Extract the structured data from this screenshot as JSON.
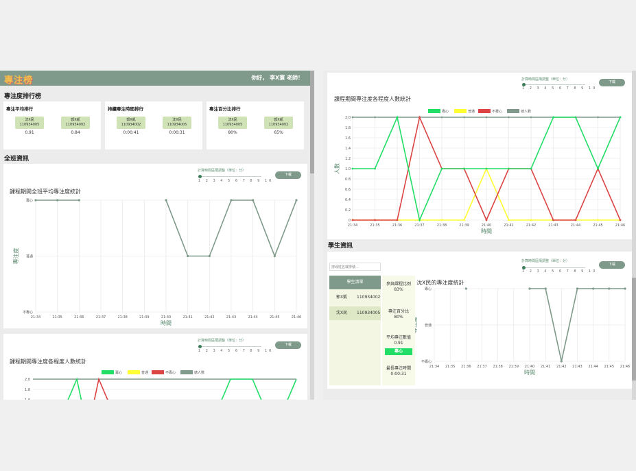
{
  "header": {
    "logo": "專注榜",
    "greeting": "你好， 李X寰 老師！"
  },
  "ranking": {
    "title": "專注度排行榜",
    "cards": [
      {
        "title": "專注平均排行",
        "entries": [
          {
            "name": "沈X民",
            "id": "110934005",
            "value": "0.91"
          },
          {
            "name": "郭X凱",
            "id": "110934002",
            "value": "0.84"
          }
        ]
      },
      {
        "title": "持續專注時間排行",
        "entries": [
          {
            "name": "郭X凱",
            "id": "110934002",
            "value": "0:00:41"
          },
          {
            "name": "沈X民",
            "id": "110934005",
            "value": "0:00:31"
          }
        ]
      },
      {
        "title": "專注百分比排行",
        "entries": [
          {
            "name": "沈X民",
            "id": "110934005",
            "value": "80%"
          },
          {
            "name": "郭X凱",
            "id": "110934002",
            "value": "65%"
          }
        ]
      }
    ]
  },
  "class_info": {
    "title": "全班資訊"
  },
  "controls": {
    "slider_label": "計算時間區隔調整（單位：分）",
    "slider_ticks": [
      "1",
      "2",
      "3",
      "4",
      "5",
      "6",
      "7",
      "8",
      "9",
      "10"
    ],
    "download_label": "下載"
  },
  "student_info": {
    "title": "學生資訊",
    "search_placeholder": "搜尋姓名或學號...",
    "list_header": "學生清單",
    "students": [
      {
        "name": "郭X凱",
        "id": "110934002"
      },
      {
        "name": "沈X民",
        "id": "110934005"
      }
    ],
    "stats": {
      "participation_label": "參與課程比例",
      "participation_value": "83%",
      "focus_pct_label": "專注百分比",
      "focus_pct_value": "80%",
      "avg_label": "平均專注數值",
      "avg_value": "0.91",
      "avg_badge": "專心",
      "longest_label": "最長專注時間",
      "longest_value": "0:00:31"
    }
  },
  "colors": {
    "header": "#7f9a8a",
    "focused": "#22dd66",
    "normal": "#ffff33",
    "unfocused": "#dd4444",
    "total": "#7f9a8a",
    "line": "#7f9a8a"
  },
  "chart_data": [
    {
      "type": "line",
      "title": "課程期間全班平均專注度統計",
      "xlabel": "時間",
      "ylabel": "專注度",
      "x": [
        "21:34",
        "21:35",
        "21:36",
        "21:37",
        "21:38",
        "21:39",
        "21:40",
        "21:41",
        "21:42",
        "21:43",
        "21:44",
        "21:45",
        "21:46"
      ],
      "y_categories": [
        "不專心",
        "普通",
        "專心"
      ],
      "series": [
        {
          "values": [
            2,
            2,
            2,
            null,
            null,
            null,
            2,
            1,
            1,
            2,
            2,
            1,
            2
          ]
        }
      ]
    },
    {
      "type": "line",
      "title": "課程期間專注度各程度人數統計",
      "xlabel": "時間",
      "ylabel": "人數",
      "x": [
        "21:34",
        "21:35",
        "21:36",
        "21:37",
        "21:38",
        "21:39",
        "21:40",
        "21:41",
        "21:42",
        "21:43",
        "21:44",
        "21:45",
        "21:46"
      ],
      "ylim": [
        0,
        2.0
      ],
      "y_ticks": [
        "0",
        "0.2",
        "0.4",
        "0.6",
        "0.8",
        "1.0",
        "1.2",
        "1.4",
        "1.6",
        "1.8",
        "2.0"
      ],
      "series": [
        {
          "name": "專心",
          "values": [
            1,
            1,
            2,
            0,
            1,
            1,
            1,
            1,
            1,
            2,
            2,
            1,
            2
          ]
        },
        {
          "name": "普通",
          "values": [
            0,
            0,
            0,
            0,
            0,
            0,
            1,
            0,
            0,
            0,
            0,
            0,
            0
          ]
        },
        {
          "name": "不專心",
          "values": [
            0,
            0,
            0,
            2,
            1,
            1,
            0,
            1,
            1,
            0,
            0,
            1,
            0
          ]
        },
        {
          "name": "總人數",
          "values": [
            2,
            2,
            2,
            2,
            2,
            2,
            2,
            2,
            2,
            2,
            2,
            2,
            2
          ]
        }
      ]
    },
    {
      "type": "line",
      "title": "沈X民的專注度統計",
      "xlabel": "時間",
      "ylabel": "專注度",
      "x": [
        "21:34",
        "21:35",
        "21:36",
        "21:37",
        "21:38",
        "21:39",
        "21:40",
        "21:41",
        "21:42",
        "21:43",
        "21:44",
        "21:45",
        "21:46"
      ],
      "y_categories": [
        "不專心",
        "普通",
        "專心"
      ],
      "series": [
        {
          "values": [
            null,
            null,
            2,
            null,
            null,
            null,
            2,
            2,
            0,
            2,
            2,
            2,
            2
          ]
        }
      ]
    }
  ]
}
